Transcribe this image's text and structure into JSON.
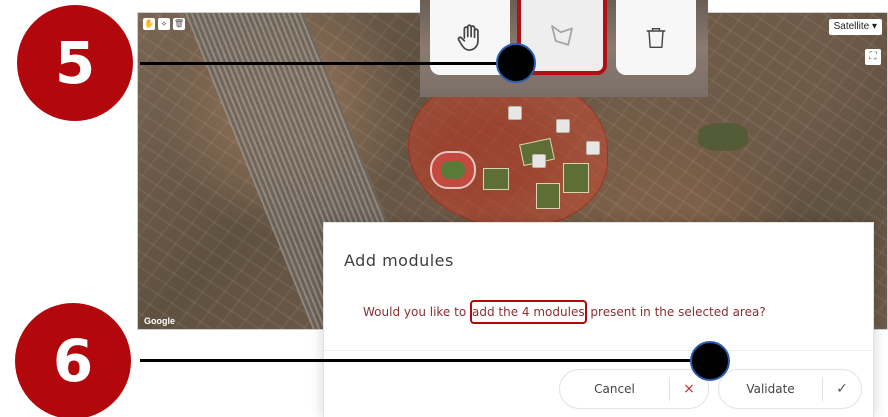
{
  "map": {
    "map_type_label": "Satellite",
    "map_type_caret": "▾",
    "attribution": "Google",
    "fullscreen_glyph": "⛶",
    "mini_toolbar": [
      "✋",
      "⟡",
      "🗑"
    ]
  },
  "toolbar_zoom": {
    "tools": [
      {
        "name": "pan",
        "icon": "hand-icon",
        "glyph": "✋"
      },
      {
        "name": "draw-polygon",
        "icon": "polygon-icon",
        "glyph": "⟡",
        "selected": true
      },
      {
        "name": "delete",
        "icon": "trash-icon",
        "glyph": "🗑"
      }
    ]
  },
  "steps": {
    "step5": "5",
    "step6": "6"
  },
  "modal": {
    "title": "Add modules",
    "message_before": "Would you like to ",
    "message_highlight": "add the 4 modules",
    "message_after": " present in the selected area?",
    "cancel_label": "Cancel",
    "cancel_icon": "×",
    "validate_label": "Validate",
    "validate_icon": "✓"
  },
  "colors": {
    "accent": "#b2080d",
    "message_text": "#8a2f33"
  }
}
